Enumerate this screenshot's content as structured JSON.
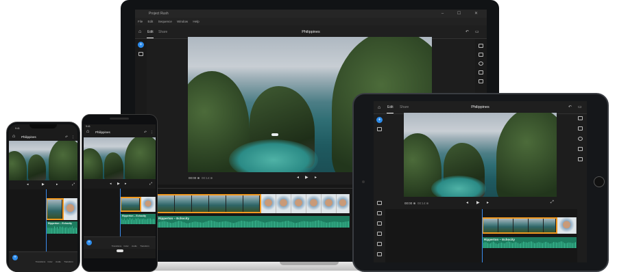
{
  "laptop": {
    "window_title": "Project Rush",
    "window_controls": "– ☐ ✕",
    "menu": [
      "File",
      "Edit",
      "Sequence",
      "Window",
      "Help"
    ],
    "tabs": {
      "edit": "Edit",
      "share": "Share"
    },
    "project_title": "Philippines",
    "playback": {
      "current_time": "00:00 ⊕",
      "duration": "00:14:⊕"
    },
    "audio_track_label": "Ripperton – Echocity"
  },
  "tablet": {
    "tabs": {
      "edit": "Edit",
      "share": "Share"
    },
    "project_title": "Philippines",
    "playback": {
      "current_time": "00:00 ⊕",
      "duration": "00:14:⊕"
    },
    "audio_track_label": "Ripperton – Echocity"
  },
  "iphone": {
    "time": "9:41",
    "project_title": "Philippines",
    "audio_track_label": "Ripperton – Echocity",
    "toolbar": [
      "Transitions",
      "Color",
      "Audio",
      "Transform"
    ]
  },
  "android": {
    "time": "9:41",
    "project_title": "Philippines",
    "audio_track_label": "Ripperton – Echocity",
    "toolbar": [
      "Transitions",
      "Color",
      "Audio",
      "Transform"
    ]
  },
  "colors": {
    "accent": "#2d8ceb",
    "video_clip_border": "#f29a20",
    "audio_clip": "#1d7c5f"
  }
}
